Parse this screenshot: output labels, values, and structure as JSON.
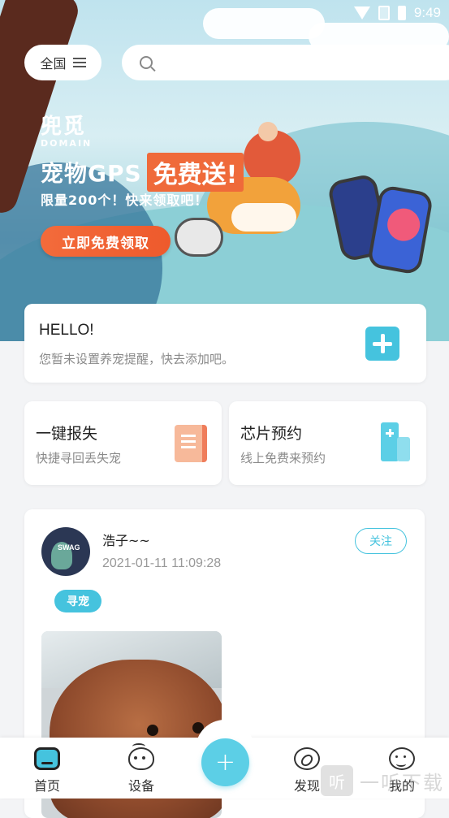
{
  "status_bar": {
    "time": "9:49"
  },
  "header": {
    "region_label": "全国",
    "search_placeholder": ""
  },
  "banner": {
    "brand_name": "兜觅",
    "brand_sub": "DOMAIN",
    "headline_left": "宠物GPS",
    "headline_highlight": "免费送!",
    "subline": "限量200个！快来领取吧！",
    "cta_label": "立即免费领取",
    "colors": {
      "cta": "#ee5a2c",
      "highlight": "#ef6a3a"
    }
  },
  "reminder_card": {
    "title": "HELLO!",
    "description": "您暂未设置养宠提醒，快去添加吧。",
    "add_icon": "plus-square-icon"
  },
  "quick_actions": [
    {
      "title": "一键报失",
      "description": "快捷寻回丢失宠",
      "icon": "scroll-icon"
    },
    {
      "title": "芯片预约",
      "description": "线上免费来预约",
      "icon": "hospital-icon"
    }
  ],
  "post": {
    "username": "浩子~~",
    "timestamp": "2021-01-11 11:09:28",
    "follow_label": "关注",
    "tag": "寻宠"
  },
  "bottom_nav": {
    "items": [
      {
        "label": "首页",
        "icon": "home-icon",
        "active": true
      },
      {
        "label": "设备",
        "icon": "device-icon"
      },
      {
        "label": "发现",
        "icon": "compass-icon"
      },
      {
        "label": "我的",
        "icon": "profile-icon"
      }
    ],
    "fab_icon": "plus-icon",
    "fab_label": "+"
  },
  "watermark": {
    "box": "听",
    "text": "一听下载"
  },
  "colors": {
    "accent": "#45c3de",
    "text_primary": "#222222",
    "text_secondary": "#8a8a8a"
  }
}
